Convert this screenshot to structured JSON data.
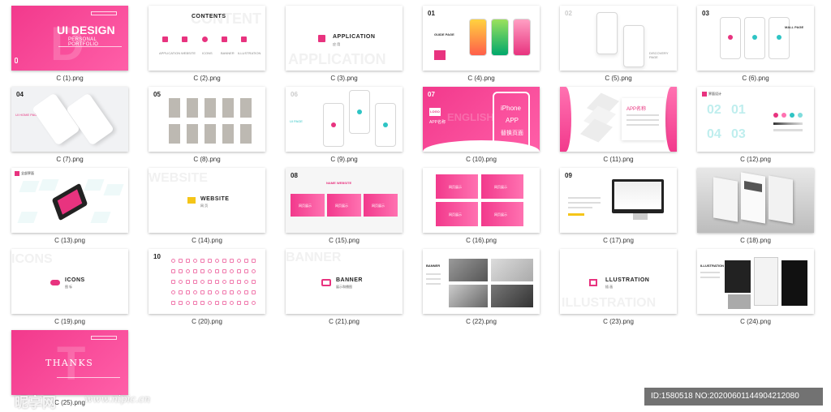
{
  "files": [
    {
      "name": "C (1).png"
    },
    {
      "name": "C (2).png"
    },
    {
      "name": "C (3).png"
    },
    {
      "name": "C (4).png"
    },
    {
      "name": "C (5).png"
    },
    {
      "name": "C (6).png"
    },
    {
      "name": "C (7).png"
    },
    {
      "name": "C (8).png"
    },
    {
      "name": "C (9).png"
    },
    {
      "name": "C (10).png"
    },
    {
      "name": "C (11).png"
    },
    {
      "name": "C (12).png"
    },
    {
      "name": "C (13).png"
    },
    {
      "name": "C (14).png"
    },
    {
      "name": "C (15).png"
    },
    {
      "name": "C (16).png"
    },
    {
      "name": "C (17).png"
    },
    {
      "name": "C (18).png"
    },
    {
      "name": "C (19).png"
    },
    {
      "name": "C (20).png"
    },
    {
      "name": "C (21).png"
    },
    {
      "name": "C (22).png"
    },
    {
      "name": "C (23).png"
    },
    {
      "name": "C (24).png"
    },
    {
      "name": "C (25).png"
    }
  ],
  "slides": {
    "s1": {
      "title": "UI DESIGN",
      "subtitle": "PERSONAL PORTFOLIO",
      "ghost": "D"
    },
    "s2": {
      "title": "CONTENTS",
      "ghost": "CONTENT",
      "items": [
        "APPLICATION",
        "WEBSITE",
        "ICONS",
        "BANNER",
        "ILLUSTRATION"
      ]
    },
    "s3": {
      "title": "APPLICATION",
      "sub": "应 用",
      "ghost": "APPLICATION"
    },
    "s4": {
      "num": "01",
      "label": "GUIDE PAGE"
    },
    "s5": {
      "num": "02",
      "label": "DISCOVERY PAGE"
    },
    "s6": {
      "num": "03",
      "label": "MALL PAGE"
    },
    "s7": {
      "num": "04",
      "label": "UI HOME PAGE"
    },
    "s8": {
      "num": "05"
    },
    "s9": {
      "num": "06",
      "label": "UI PAGE"
    },
    "s10": {
      "num": "07",
      "logo": "LOGO",
      "app": "APP名称",
      "line1": "iPhone",
      "line2": "APP",
      "line3": "替换页面",
      "ghost": "ENGLISH"
    },
    "s11": {
      "label": "APP名称"
    },
    "s12": {
      "label": "界面设计"
    },
    "s13": {
      "label": "全部界面"
    },
    "s14": {
      "title": "WEBSITE",
      "sub": "网 页",
      "ghost": "WEBSITE"
    },
    "s15": {
      "num": "08",
      "label": "NAME WEBSITE",
      "cards": [
        "网页展示",
        "网页展示",
        "网页展示"
      ]
    },
    "s16": {
      "cards": [
        "网页展示",
        "网页展示",
        "网页展示",
        "网页展示"
      ]
    },
    "s17": {
      "num": "09"
    },
    "s19": {
      "title": "ICONS",
      "sub": "图 标",
      "ghost": "ICONS"
    },
    "s20": {
      "num": "10"
    },
    "s21": {
      "title": "BANNER",
      "sub": "展示和播图",
      "ghost": "BANNER"
    },
    "s22": {
      "label": "BANNER"
    },
    "s23": {
      "title": "LLUSTRATION",
      "sub": "插 画",
      "ghost": "ILLUSTRATION"
    },
    "s24": {
      "label": "ILLUSTRATION"
    },
    "s25": {
      "title": "THANKS",
      "ghost": "T"
    }
  },
  "watermark": {
    "logo": "昵享网",
    "url": "www.nipic.cn",
    "id": "ID:1580518 NO:20200601144904212080"
  },
  "colors": {
    "accent": "#e8337f",
    "accent_light": "#ff72b1",
    "teal": "#2ec4c4"
  }
}
